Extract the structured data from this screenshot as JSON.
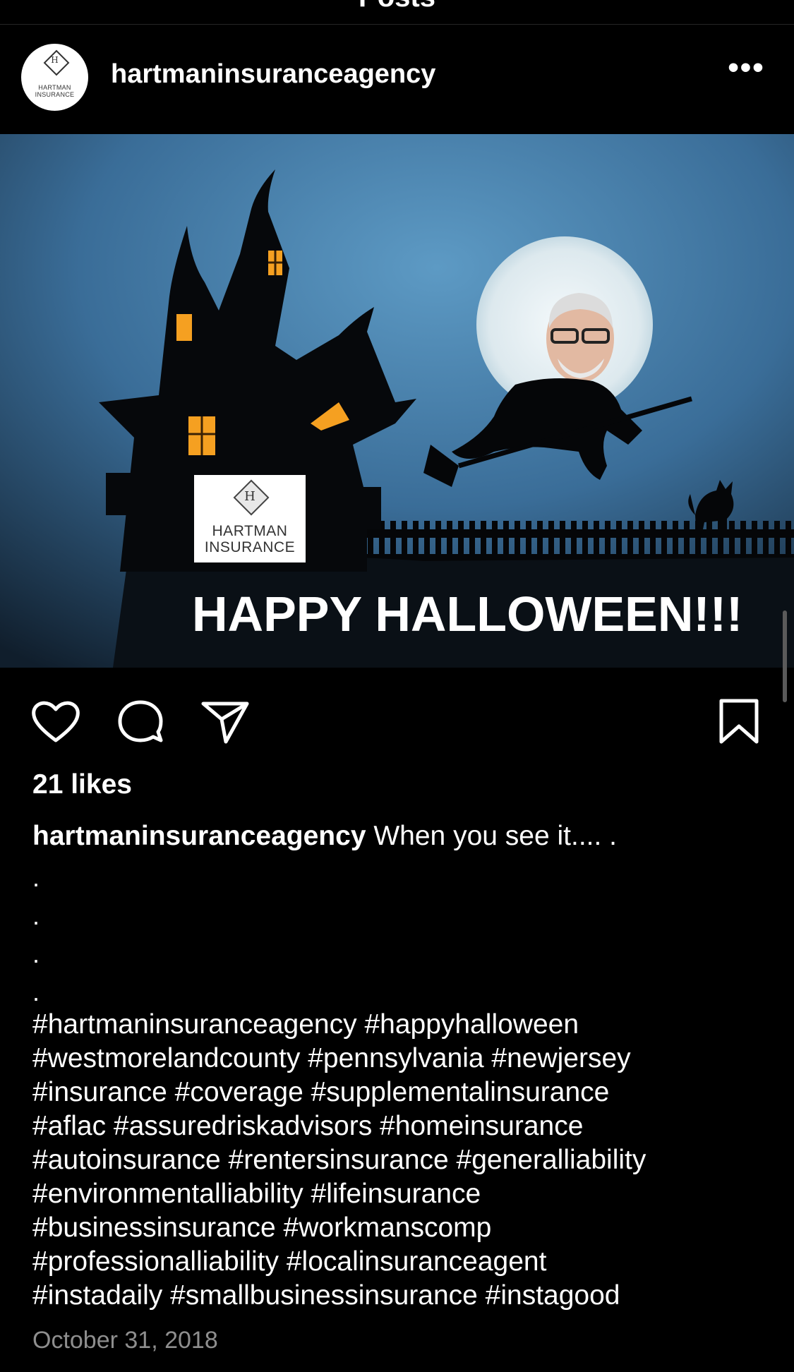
{
  "header_title": "Posts",
  "post": {
    "username": "hartmaninsuranceagency",
    "avatar": {
      "letter": "H",
      "brand": "HARTMAN INSURANCE"
    },
    "more_icon": "more-horizontal-icon",
    "image": {
      "logo_letter": "H",
      "logo_line1": "HARTMAN",
      "logo_line2": "INSURANCE",
      "headline": "HAPPY HALLOWEEN!!!"
    },
    "actions": {
      "like_icon": "heart-icon",
      "comment_icon": "comment-icon",
      "share_icon": "share-icon",
      "save_icon": "bookmark-icon"
    },
    "likes": "21 likes",
    "caption_user": "hartmaninsuranceagency",
    "caption_text": " When you see it.... .",
    "caption_dots": [
      ".",
      ".",
      ".",
      "."
    ],
    "hashtags": [
      "#hartmaninsuranceagency #happyhalloween",
      "#westmorelandcounty #pennsylvania #newjersey",
      "#insurance #coverage #supplementalinsurance",
      "#aflac #assuredriskadvisors #homeinsurance",
      "#autoinsurance #rentersinsurance #generalliability",
      "#environmentalliability #lifeinsurance",
      "#businessinsurance #workmanscomp",
      "#professionalliability #localinsuranceagent",
      "#instadaily #smallbusinessinsurance #instagood"
    ],
    "date": "October 31, 2018"
  },
  "colors": {
    "background": "#000000",
    "text": "#ffffff",
    "muted": "#8e8e8e",
    "sky": "#3f78a8",
    "moon": "#e8f1f5"
  }
}
